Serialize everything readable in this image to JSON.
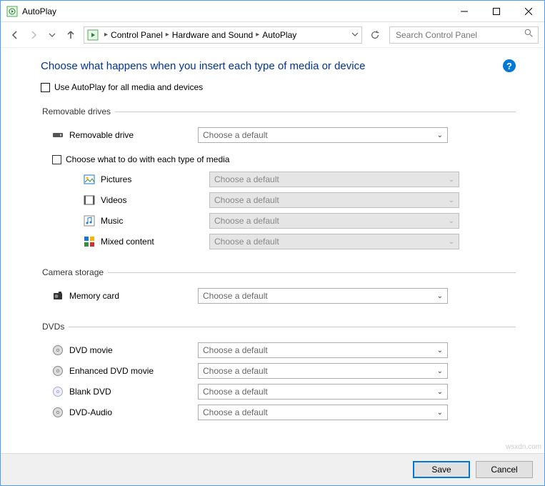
{
  "window": {
    "title": "AutoPlay"
  },
  "breadcrumb": {
    "root": "Control Panel",
    "mid": "Hardware and Sound",
    "leaf": "AutoPlay"
  },
  "search": {
    "placeholder": "Search Control Panel"
  },
  "heading": "Choose what happens when you insert each type of media or device",
  "global_checkbox_label": "Use AutoPlay for all media and devices",
  "media_type_checkbox_label": "Choose what to do with each type of media",
  "default_option": "Choose a default",
  "sections": {
    "removable": {
      "legend": "Removable drives",
      "main": {
        "label": "Removable drive",
        "enabled": true
      },
      "subs": [
        {
          "label": "Pictures",
          "enabled": false
        },
        {
          "label": "Videos",
          "enabled": false
        },
        {
          "label": "Music",
          "enabled": false
        },
        {
          "label": "Mixed content",
          "enabled": false
        }
      ]
    },
    "camera": {
      "legend": "Camera storage",
      "main": {
        "label": "Memory card",
        "enabled": true
      }
    },
    "dvds": {
      "legend": "DVDs",
      "items": [
        {
          "label": "DVD movie",
          "enabled": true
        },
        {
          "label": "Enhanced DVD movie",
          "enabled": true
        },
        {
          "label": "Blank DVD",
          "enabled": true
        },
        {
          "label": "DVD-Audio",
          "enabled": true
        }
      ]
    }
  },
  "footer": {
    "save": "Save",
    "cancel": "Cancel"
  },
  "watermark": "wsxdn.com"
}
